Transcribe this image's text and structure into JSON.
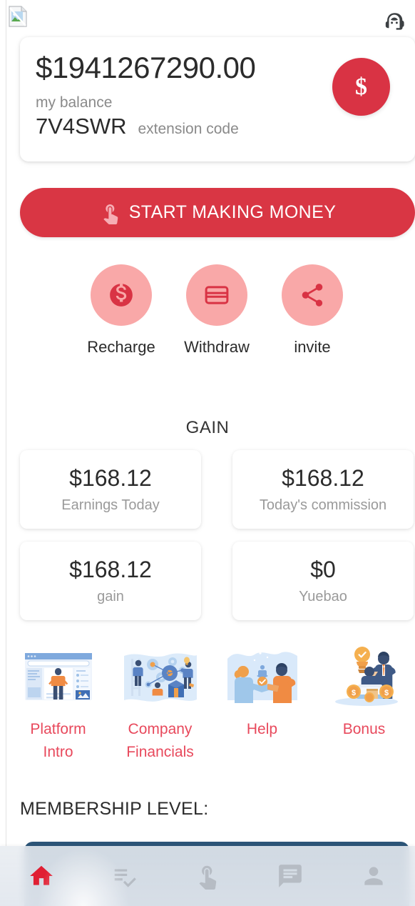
{
  "header": {
    "broken_image_icon": "broken-image-icon",
    "support_icon": "headset-support-icon"
  },
  "balance": {
    "amount": "$1941267290.00",
    "label": "my balance",
    "extension_code": "7V4SWR",
    "extension_label": "extension code",
    "badge_symbol": "$",
    "badge_icon": "dollar-badge-icon",
    "accent_color": "#d93344"
  },
  "cta": {
    "label": "START MAKING MONEY",
    "icon": "touch-app-icon",
    "background_color": "#d93644",
    "text_color": "#ffffff"
  },
  "quick_actions": [
    {
      "label": "Recharge",
      "icon": "monetization-on-icon"
    },
    {
      "label": "Withdraw",
      "icon": "credit-card-icon"
    },
    {
      "label": "invite",
      "icon": "share-icon"
    }
  ],
  "gain": {
    "title": "GAIN",
    "cards": [
      {
        "value": "$168.12",
        "label": "Earnings Today"
      },
      {
        "value": "$168.12",
        "label": "Today's commission"
      },
      {
        "value": "$168.12",
        "label": "gain"
      },
      {
        "value": "$0",
        "label": "Yuebao"
      }
    ]
  },
  "entries": [
    {
      "label": "Platform Intro",
      "icon": "platform-intro-illustration"
    },
    {
      "label": "Company Financials",
      "icon": "company-financials-illustration"
    },
    {
      "label": "Help",
      "icon": "help-handshake-illustration"
    },
    {
      "label": "Bonus",
      "icon": "bonus-reward-illustration"
    }
  ],
  "membership": {
    "title": "MEMBERSHIP LEVEL:",
    "card_color": "#2c5578"
  },
  "bottom_nav": [
    {
      "icon": "home-icon",
      "active": true
    },
    {
      "icon": "playlist-add-check-icon",
      "active": false
    },
    {
      "icon": "touch-app-icon",
      "active": false
    },
    {
      "icon": "chat-message-icon",
      "active": false
    },
    {
      "icon": "person-icon",
      "active": false
    }
  ],
  "colors": {
    "primary_red": "#d93644",
    "light_pink": "#f9a8a8",
    "link_red": "#e8495c",
    "navy": "#2c5578",
    "nav_active": "#e01f33"
  }
}
